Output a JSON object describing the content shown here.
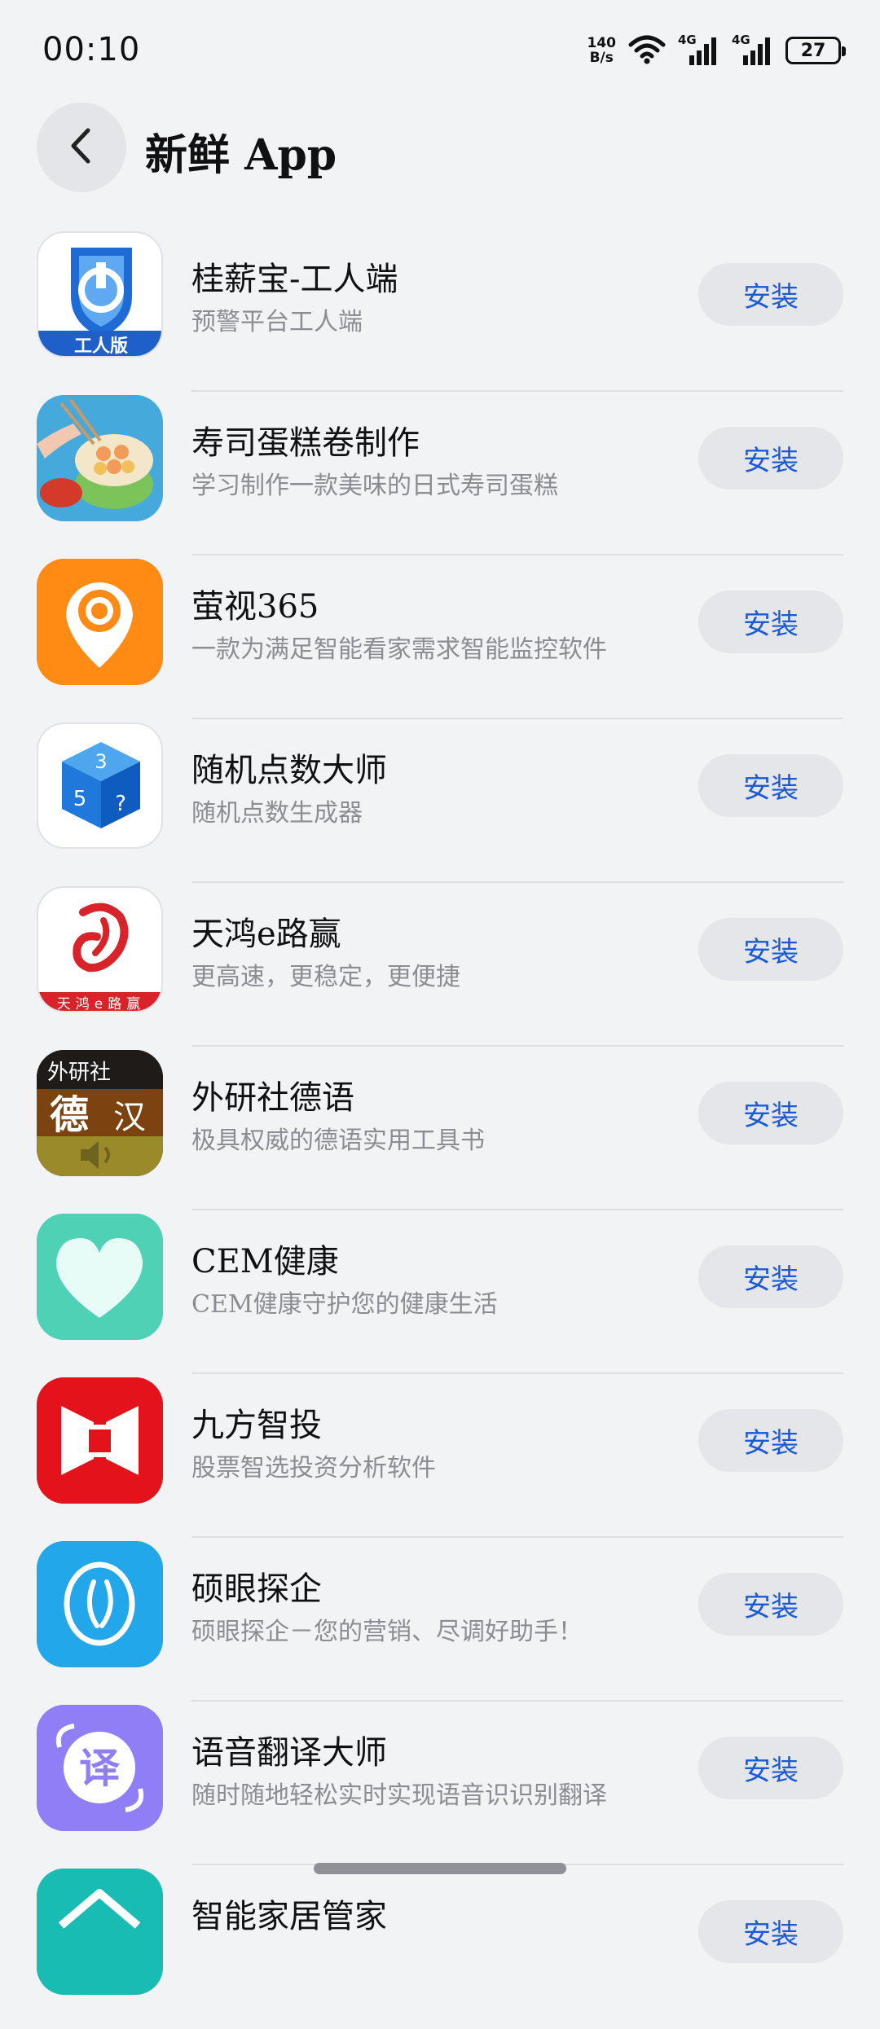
{
  "status_bar": {
    "time": "00:10",
    "net_speed_value": "140",
    "net_speed_unit": "B/s",
    "signal_1_label": "4G",
    "signal_2_label": "4G",
    "battery": "27"
  },
  "header": {
    "title": "新鲜 App"
  },
  "apps": [
    {
      "name": "桂薪宝-工人端",
      "desc": "预警平台工人端",
      "button": "安装",
      "icon_name": "shield-app-icon",
      "icon_text": "工人版"
    },
    {
      "name": "寿司蛋糕卷制作",
      "desc": "学习制作一款美味的日式寿司蛋糕",
      "button": "安装",
      "icon_name": "sushi-cake-icon"
    },
    {
      "name": "萤视365",
      "desc": "一款为满足智能看家需求智能监控软件",
      "button": "安装",
      "icon_name": "camera-pin-icon"
    },
    {
      "name": "随机点数大师",
      "desc": "随机点数生成器",
      "button": "安装",
      "icon_name": "dice-cube-icon",
      "icon_text": [
        "3",
        "5",
        "?"
      ]
    },
    {
      "name": "天鸿e路赢",
      "desc": "更高速，更稳定，更便捷",
      "button": "安装",
      "icon_name": "tianhong-logo-icon",
      "icon_text": "天鸿e路赢"
    },
    {
      "name": "外研社德语",
      "desc": "极具权威的德语实用工具书",
      "button": "安装",
      "icon_name": "german-dictionary-icon",
      "icon_text": [
        "外研社",
        "德",
        "汉"
      ]
    },
    {
      "name": "CEM健康",
      "desc": "CEM健康守护您的健康生活",
      "button": "安装",
      "icon_name": "heart-icon"
    },
    {
      "name": "九方智投",
      "desc": "股票智选投资分析软件",
      "button": "安装",
      "icon_name": "jiufang-logo-icon"
    },
    {
      "name": "硕眼探企",
      "desc": "硕眼探企－您的营销、尽调好助手！",
      "button": "安装",
      "icon_name": "seed-logo-icon"
    },
    {
      "name": "语音翻译大师",
      "desc": "随时随地轻松实时实现语音识识别翻译",
      "button": "安装",
      "icon_name": "translate-icon",
      "icon_text": "译"
    },
    {
      "name": "智能家居管家",
      "desc": "",
      "button": "安装",
      "icon_name": "partial-house-icon"
    }
  ],
  "colors": {
    "background": "#f1f3f5",
    "accent": "#1a5ad7",
    "button_bg": "#e4e6ea"
  }
}
